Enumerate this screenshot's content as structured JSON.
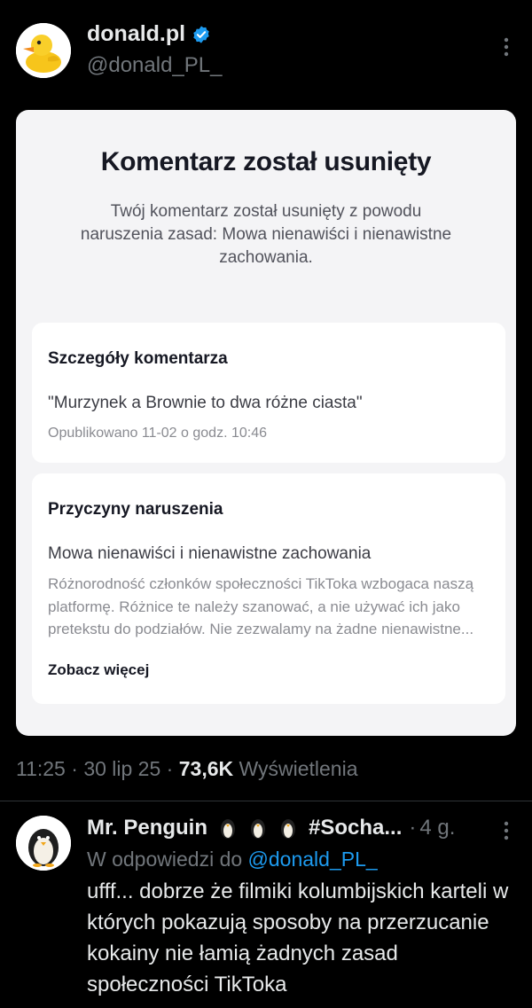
{
  "post": {
    "author_name": "donald.pl",
    "author_handle": "@donald_PL_",
    "verified": true
  },
  "card": {
    "title": "Komentarz został usunięty",
    "subtitle": "Twój komentarz został usunięty z powodu naruszenia zasad: Mowa nienawiści i nienawistne zachowania.",
    "details_heading": "Szczegóły komentarza",
    "quote": "\"Murzynek a Brownie to dwa różne ciasta\"",
    "published": "Opublikowano 11-02 o godz. 10:46",
    "reasons_heading": "Przyczyny naruszenia",
    "reason_title": "Mowa nienawiści i nienawistne zachowania",
    "reason_body": "Różnorodność członków społeczności TikToka wzbogaca naszą platformę. Różnice te należy szanować, a nie używać ich jako pretekstu do podziałów. Nie zezwalamy na żadne nienawistne...",
    "see_more": "Zobacz więcej"
  },
  "meta": {
    "time": "11:25",
    "date": "30 lip 25",
    "views": "73,6K",
    "views_label": "Wyświetlenia"
  },
  "reply": {
    "name_prefix": "Mr. Penguin",
    "name_suffix": "#Socha...",
    "time": "4 g.",
    "replying_label": "W odpowiedzi do",
    "replying_handle": "@donald_PL_",
    "text": "ufff... dobrze że filmiki kolumbijskich karteli w których pokazują sposoby na przerzucanie kokainy  nie łamią żadnych zasad społeczności TikToka"
  },
  "colors": {
    "background": "#000000",
    "accent": "#1d9bf0",
    "muted": "#71767b",
    "text": "#e7e9ea"
  },
  "icons": [
    "duck-avatar-icon",
    "verified-badge-icon",
    "more-options-icon",
    "penguin-avatar-icon",
    "penguin-emoji-icon"
  ]
}
